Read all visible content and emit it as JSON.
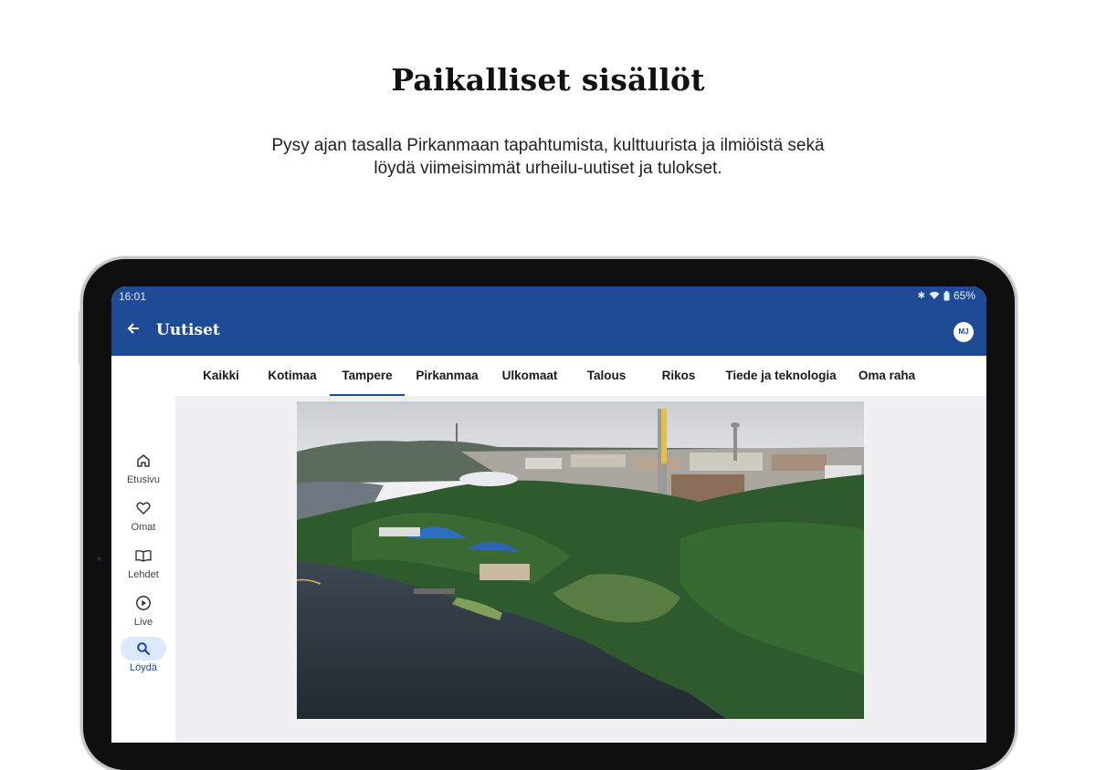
{
  "headline": "Paikalliset sisällöt",
  "subtitle_line1": "Pysy ajan tasalla Pirkanmaan tapahtumista, kulttuurista ja ilmiöistä sekä",
  "subtitle_line2": "löydä viimeisimmät urheilu-uutiset ja tulokset.",
  "status": {
    "time": "16:01",
    "battery": "65%"
  },
  "appbar": {
    "title": "Uutiset",
    "avatar": "MJ"
  },
  "tabs": [
    {
      "label": "Kaikki"
    },
    {
      "label": "Kotimaa"
    },
    {
      "label": "Tampere",
      "active": true
    },
    {
      "label": "Pirkanmaa"
    },
    {
      "label": "Ulkomaat"
    },
    {
      "label": "Talous"
    },
    {
      "label": "Rikos"
    },
    {
      "label": "Tiede ja teknologia"
    },
    {
      "label": "Oma raha"
    }
  ],
  "rail": [
    {
      "label": "Etusivu",
      "icon": "home-icon"
    },
    {
      "label": "Omat",
      "icon": "heart-icon"
    },
    {
      "label": "Lehdet",
      "icon": "book-icon"
    },
    {
      "label": "Live",
      "icon": "play-icon"
    },
    {
      "label": "Löydä",
      "icon": "search-icon",
      "active": true
    }
  ],
  "colors": {
    "brand": "#1e4a96",
    "active_pill": "#dce8fb"
  }
}
